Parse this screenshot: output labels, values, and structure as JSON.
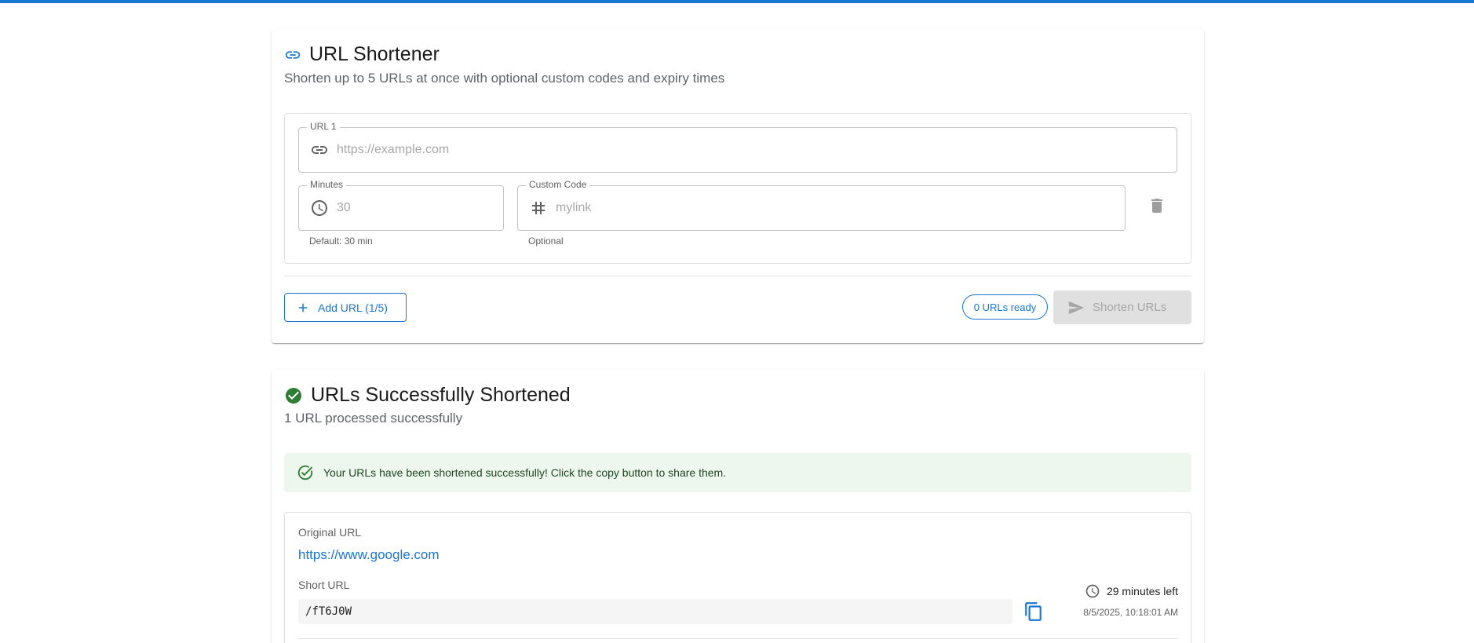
{
  "shortener": {
    "title": "URL Shortener",
    "subtitle": "Shorten up to 5 URLs at once with optional custom codes and expiry times",
    "url_field": {
      "label": "URL 1",
      "placeholder": "https://example.com"
    },
    "minutes_field": {
      "label": "Minutes",
      "placeholder": "30",
      "helper": "Default: 30 min"
    },
    "code_field": {
      "label": "Custom Code",
      "placeholder": "mylink",
      "helper": "Optional"
    },
    "add_button": "Add URL (1/5)",
    "ready_chip": "0 URLs ready",
    "submit_button": "Shorten URLs"
  },
  "results": {
    "title": "URLs Successfully Shortened",
    "subtitle": "1 URL processed successfully",
    "alert": "Your URLs have been shortened successfully! Click the copy button to share them.",
    "item": {
      "original_label": "Original URL",
      "original_url": "https://www.google.com",
      "short_label": "Short URL",
      "short_url": "/fT6J0W",
      "time_left": "29 minutes left",
      "expires": "8/5/2025, 10:18:01 AM"
    }
  },
  "colors": {
    "primary": "#1976d2",
    "success": "#2e7d32",
    "success_bg": "#edf7ed"
  }
}
